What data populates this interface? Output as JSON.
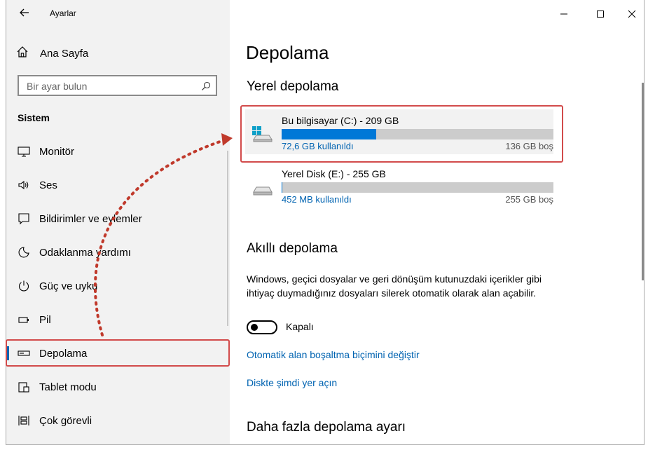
{
  "window": {
    "app_title": "Ayarlar",
    "back_icon": "back-arrow-icon",
    "controls": [
      "minimize-icon",
      "maximize-icon",
      "close-icon"
    ]
  },
  "sidebar": {
    "home_label": "Ana Sayfa",
    "search_placeholder": "Bir ayar bulun",
    "section_title": "Sistem",
    "items": [
      {
        "label": "Monitör",
        "icon": "monitor-icon"
      },
      {
        "label": "Ses",
        "icon": "speaker-icon"
      },
      {
        "label": "Bildirimler ve eylemler",
        "icon": "notification-icon"
      },
      {
        "label": "Odaklanma yardımı",
        "icon": "moon-icon"
      },
      {
        "label": "Güç ve uyku",
        "icon": "power-icon"
      },
      {
        "label": "Pil",
        "icon": "battery-icon"
      },
      {
        "label": "Depolama",
        "icon": "storage-icon",
        "active": true
      },
      {
        "label": "Tablet modu",
        "icon": "tablet-icon"
      },
      {
        "label": "Çok görevli",
        "icon": "multitask-icon"
      }
    ]
  },
  "main": {
    "title": "Depolama",
    "local_storage_title": "Yerel depolama",
    "drives": [
      {
        "name": "Bu bilgisayar (C:) - 209 GB",
        "used": "72,6 GB kullanıldı",
        "free": "136 GB boş",
        "used_fraction": 0.347,
        "icon": "windows-drive-icon"
      },
      {
        "name": "Yerel Disk (E:) - 255 GB",
        "used": "452 MB kullanıldı",
        "free": "255 GB boş",
        "used_fraction": 0.002,
        "icon": "drive-icon"
      }
    ],
    "smart_storage_title": "Akıllı depolama",
    "smart_storage_desc": "Windows, geçici dosyalar ve geri dönüşüm kutunuzdaki içerikler gibi ihtiyaç duymadığınız dosyaları silerek otomatik olarak alan açabilir.",
    "toggle_label": "Kapalı",
    "toggle_on": false,
    "link_change": "Otomatik alan boşaltma biçimini değiştir",
    "link_free_now": "Diskte şimdi yer açın",
    "more_settings_title": "Daha fazla depolama ayarı"
  },
  "colors": {
    "accent": "#0078d7",
    "link": "#0063b1",
    "annotation_red": "#d24b4b"
  }
}
